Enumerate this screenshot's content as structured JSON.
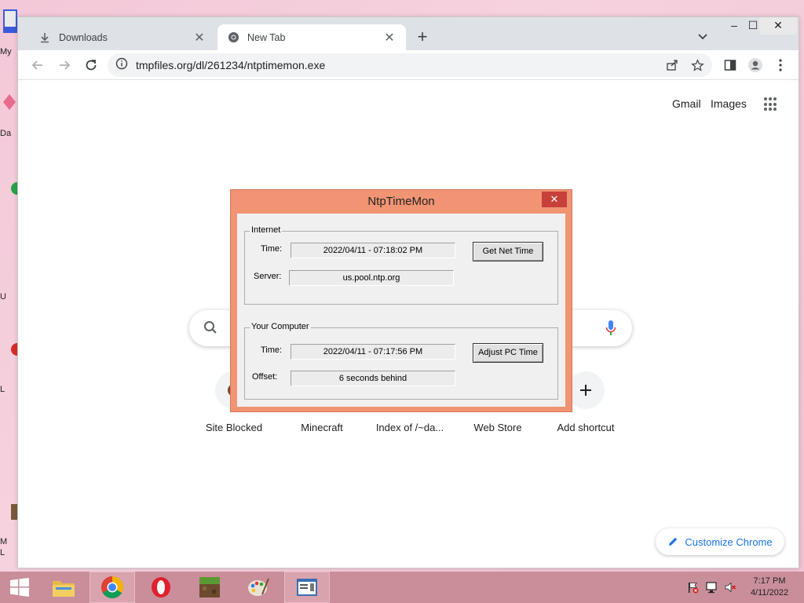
{
  "desktop": {
    "labels": [
      "My",
      "Da",
      "U",
      "L",
      "M",
      "L"
    ]
  },
  "browser": {
    "tabs": [
      {
        "title": "Downloads",
        "icon": "download-icon"
      },
      {
        "title": "New Tab",
        "icon": "chrome-icon"
      }
    ],
    "url": "tmpfiles.org/dl/261234/ntptimemon.exe"
  },
  "ntp": {
    "links": [
      "Gmail",
      "Images"
    ],
    "shortcuts": [
      "Site Blocked",
      "Minecraft",
      "Index of /~da...",
      "Web Store",
      "Add shortcut"
    ],
    "customize_label": "Customize Chrome"
  },
  "dialog": {
    "title": "NtpTimeMon",
    "internet": {
      "legend": "Internet",
      "time_label": "Time:",
      "time_value": "2022/04/11 - 07:18:02 PM",
      "server_label": "Server:",
      "server_value": "us.pool.ntp.org",
      "button": "Get Net Time"
    },
    "computer": {
      "legend": "Your Computer",
      "time_label": "Time:",
      "time_value": "2022/04/11 - 07:17:56 PM",
      "offset_label": "Offset:",
      "offset_value": "6 seconds behind",
      "button": "Adjust PC Time"
    }
  },
  "taskbar": {
    "clock_time": "7:17 PM",
    "clock_date": "4/11/2022",
    "apps": [
      "file-explorer-icon",
      "chrome-icon",
      "opera-icon",
      "minecraft-icon",
      "paint-icon",
      "ntptimemon-icon"
    ]
  },
  "colors": {
    "dialog_frame": "#f19473",
    "close_red": "#c7403a",
    "taskbar": "#c98e9a",
    "link_blue": "#1a73e8"
  }
}
